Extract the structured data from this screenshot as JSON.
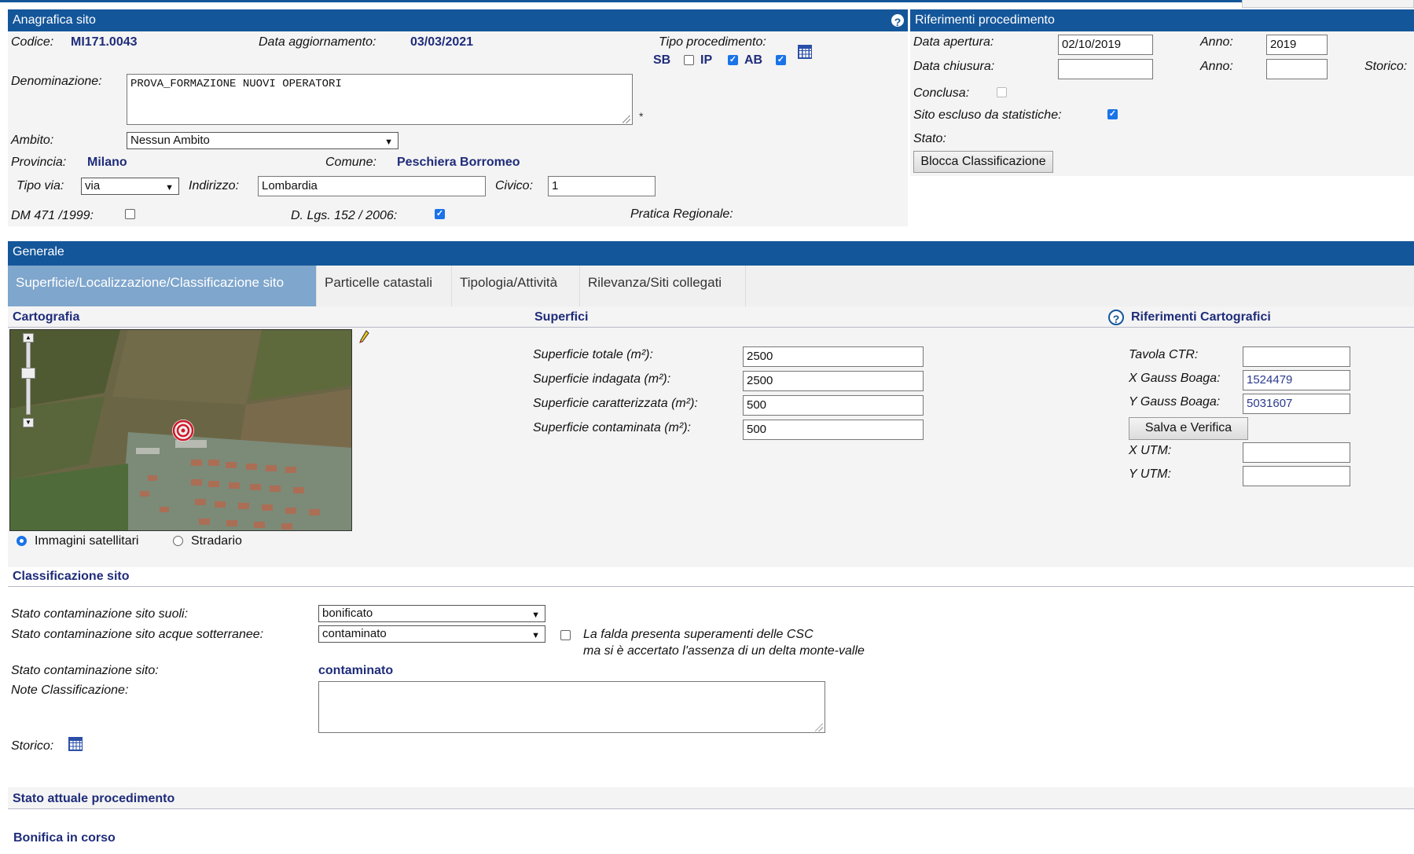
{
  "anagrafica": {
    "header": "Anagrafica sito",
    "codice_label": "Codice:",
    "codice": "MI171.0043",
    "data_agg_label": "Data aggiornamento:",
    "data_agg": "03/03/2021",
    "tipo_proc_label": "Tipo procedimento:",
    "tipo_sb": "SB",
    "tipo_ip": "IP",
    "tipo_ab": "AB",
    "denominazione_label": "Denominazione:",
    "denominazione": "PROVA_FORMAZIONE NUOVI OPERATORI",
    "asterisk": "*",
    "ambito_label": "Ambito:",
    "ambito": "Nessun Ambito",
    "provincia_label": "Provincia:",
    "provincia": "Milano",
    "comune_label": "Comune:",
    "comune": "Peschiera Borromeo",
    "tipo_via_label": "Tipo via:",
    "tipo_via": "via",
    "indirizzo_label": "Indirizzo:",
    "indirizzo": "Lombardia",
    "civico_label": "Civico:",
    "civico": "1",
    "dm_label": "DM 471 /1999:",
    "dlgs_label": "D. Lgs. 152 / 2006:",
    "pratica_label": "Pratica Regionale:"
  },
  "riferimenti": {
    "header": "Riferimenti procedimento",
    "apertura_label": "Data apertura:",
    "apertura": "02/10/2019",
    "anno_label": "Anno:",
    "anno_apertura": "2019",
    "chiusura_label": "Data chiusura:",
    "chiusura": "",
    "anno_chiusura": "",
    "storico_label": "Storico:",
    "conclusa_label": "Conclusa:",
    "escluso_label": "Sito escluso da statistiche:",
    "stato_label": "Stato:",
    "blocca_btn": "Blocca Classificazione"
  },
  "generale": {
    "header": "Generale",
    "tabs": [
      "Superficie/Localizzazione/Classificazione sito",
      "Particelle catastali",
      "Tipologia/Attività",
      "Rilevanza/Siti collegati"
    ]
  },
  "cartografia": {
    "title": "Cartografia",
    "radio_sat": "Immagini satellitari",
    "radio_strad": "Stradario"
  },
  "superfici": {
    "title": "Superfici",
    "totale_label": "Superficie totale (m²):",
    "totale": "2500",
    "indagata_label": "Superficie indagata (m²):",
    "indagata": "2500",
    "caratterizzata_label": "Superficie caratterizzata (m²):",
    "caratterizzata": "500",
    "contaminata_label": "Superficie contaminata (m²):",
    "contaminata": "500"
  },
  "rif_carto": {
    "title": "Riferimenti Cartografici",
    "ctr_label": "Tavola CTR:",
    "ctr": "",
    "xgb_label": "X Gauss Boaga:",
    "xgb": "1524479",
    "ygb_label": "Y Gauss Boaga:",
    "ygb": "5031607",
    "salva_btn": "Salva e Verifica",
    "xutm_label": "X UTM:",
    "xutm": "",
    "yutm_label": "Y UTM:",
    "yutm": ""
  },
  "classificazione": {
    "title": "Classificazione sito",
    "suoli_label": "Stato contaminazione sito suoli:",
    "suoli": "bonificato",
    "acque_label": "Stato contaminazione sito acque sotterranee:",
    "acque": "contaminato",
    "falda_line1": "La falda presenta superamenti delle CSC",
    "falda_line2": "ma si è accertato l'assenza di un delta monte-valle",
    "sito_label": "Stato contaminazione sito:",
    "sito": "contaminato",
    "note_label": "Note Classificazione:",
    "storico_label": "Storico:"
  },
  "stato_attuale": {
    "title": "Stato attuale procedimento",
    "value": "Bonifica in corso"
  },
  "colors": {
    "header_bg": "#14569a",
    "label_blue": "#1f2c7a",
    "tab_active": "#7fa6cc"
  }
}
